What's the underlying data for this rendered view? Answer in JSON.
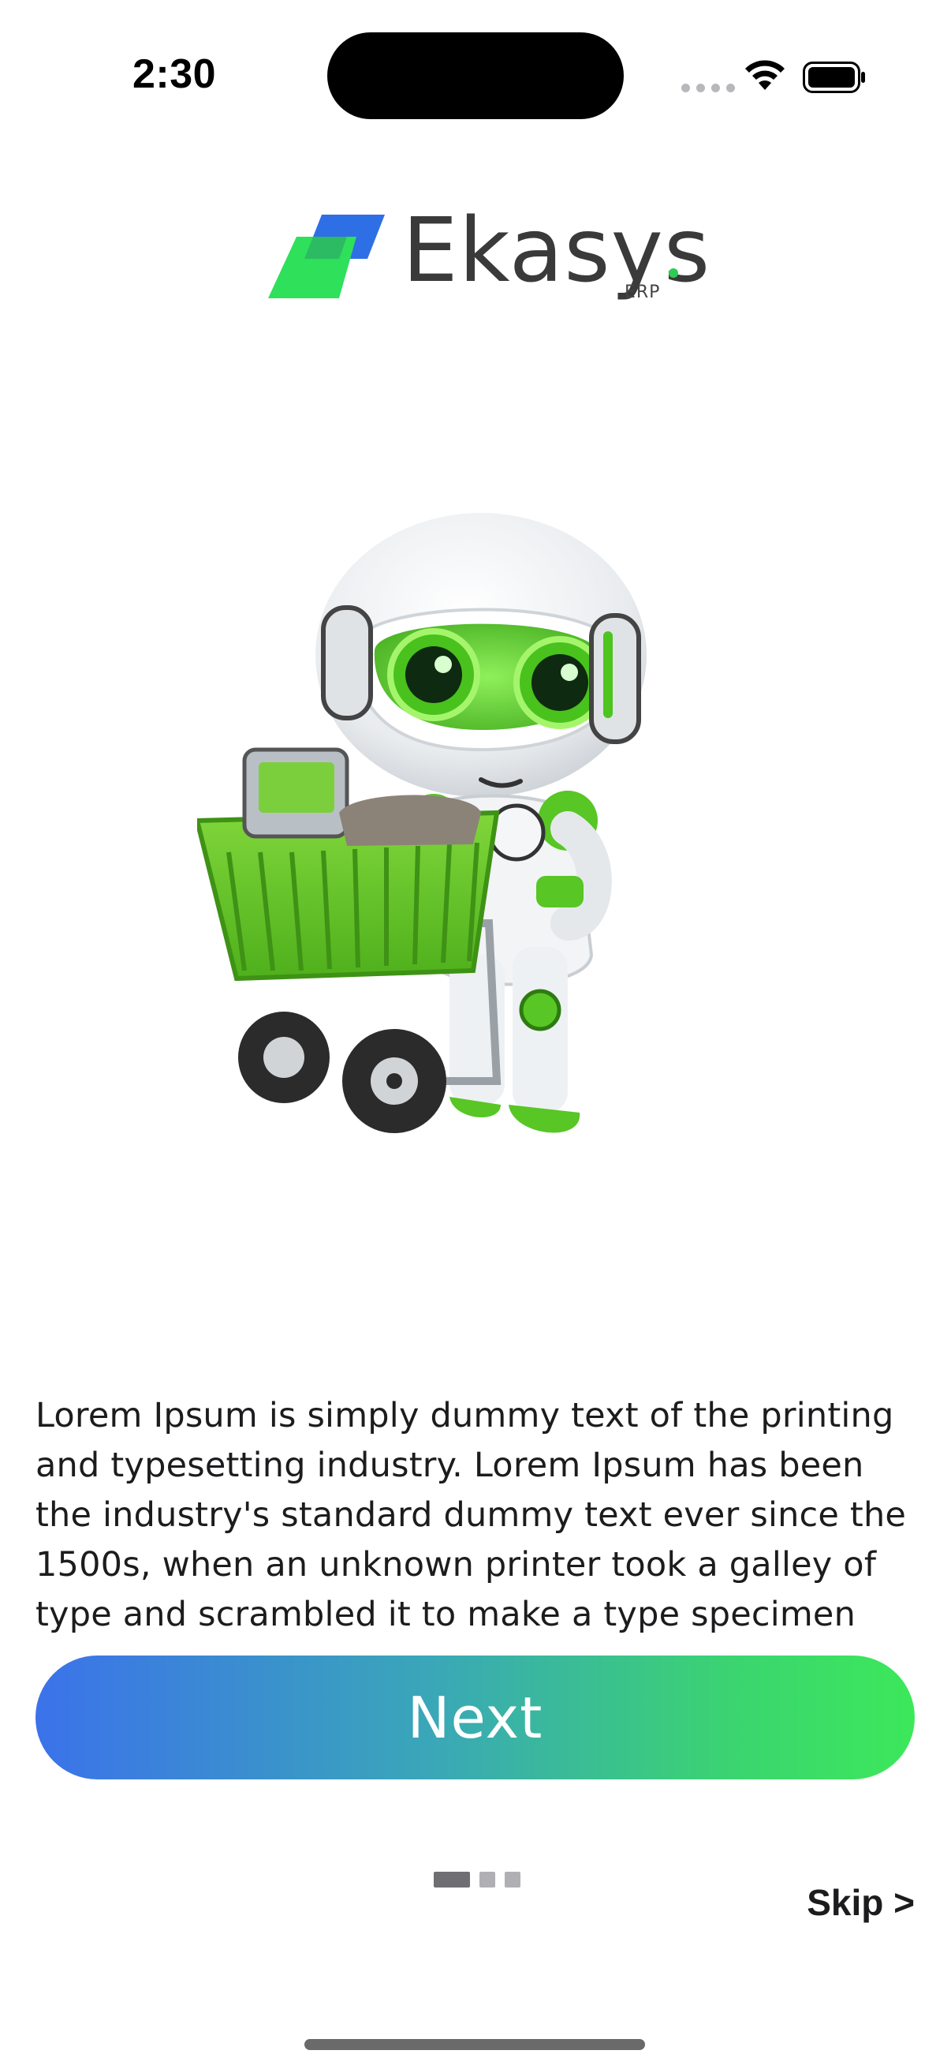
{
  "status_bar": {
    "time": "2:30",
    "wifi_icon": "wifi-icon",
    "battery_icon": "battery-icon"
  },
  "brand": {
    "name": "Ekasys",
    "sub": "ERP",
    "mark_colors": [
      "#2ee05a",
      "#2f6fe6"
    ],
    "accent_dot": "#2ecc55"
  },
  "hero": {
    "icon": "robot-shopping-cart-illustration"
  },
  "onboarding": {
    "description": "Lorem Ipsum is simply dummy text of the printing and typesetting industry. Lorem Ipsum has been the industry's standard dummy text ever since the 1500s, when an unknown printer took a galley of type and scrambled it to make a type specimen",
    "next_label": "Next",
    "skip_label": "Skip >",
    "page_count": 3,
    "current_page": 1
  },
  "colors": {
    "gradient_start": "#3b72ea",
    "gradient_end": "#3ce85a",
    "text": "#1c1c1e"
  }
}
